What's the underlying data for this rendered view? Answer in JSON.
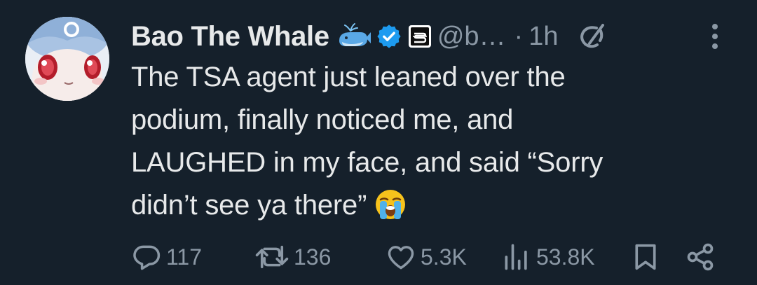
{
  "tweet": {
    "display_name": "Bao The Whale",
    "handle": "@b…",
    "separator": "·",
    "time": "1h",
    "text_lines": [
      "The TSA agent just leaned over the",
      "podium, finally noticed me, and",
      "LAUGHED in my face, and said “Sorry",
      "didn’t see ya there”"
    ],
    "icons": {
      "name_emoji": "whale-emoji-icon",
      "verified": "verified-badge-icon",
      "affiliation": "affiliate-badge-icon",
      "grok": "grok-icon",
      "more": "more-options-icon",
      "text_emoji": "loudly-crying-face-emoji-icon"
    }
  },
  "actions": {
    "reply": {
      "icon": "reply-icon",
      "count": "117"
    },
    "retweet": {
      "icon": "retweet-icon",
      "count": "136"
    },
    "like": {
      "icon": "heart-icon",
      "count": "5.3K"
    },
    "views": {
      "icon": "views-icon",
      "count": "53.8K"
    },
    "bookmark": {
      "icon": "bookmark-icon"
    },
    "share": {
      "icon": "share-icon"
    }
  },
  "colors": {
    "background": "#15202b",
    "primary_text": "#e7e9ea",
    "secondary_text": "#8b98a5",
    "verified_blue": "#1d9bf0"
  }
}
